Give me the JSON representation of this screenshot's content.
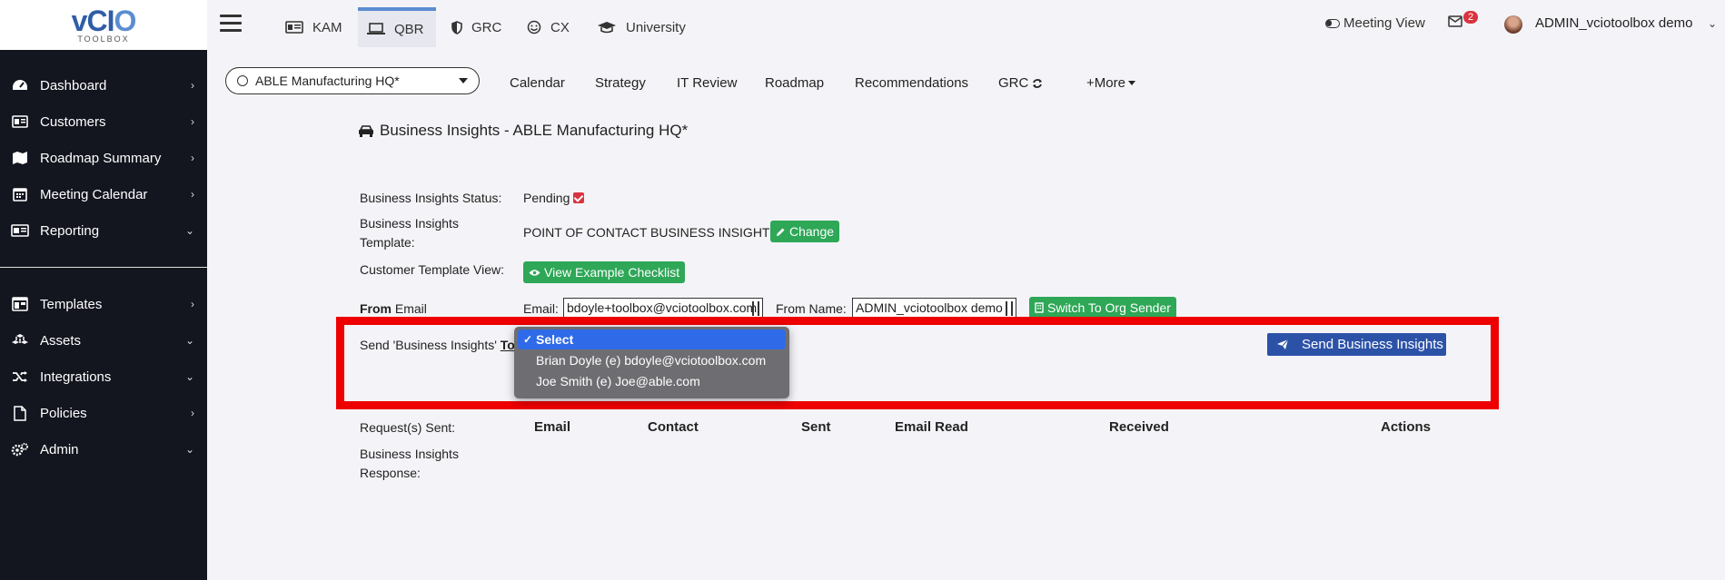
{
  "logo": {
    "main_v": "v",
    "main_c": "C",
    "main_i": "I",
    "main_o": "O",
    "sub": "TOOLBOX"
  },
  "sidebar": {
    "items": [
      {
        "label": "Dashboard",
        "icon": "dashboard-icon",
        "chevron": "›"
      },
      {
        "label": "Customers",
        "icon": "id-card-icon",
        "chevron": "›"
      },
      {
        "label": "Roadmap Summary",
        "icon": "map-icon",
        "chevron": "›"
      },
      {
        "label": "Meeting Calendar",
        "icon": "calendar-icon",
        "chevron": "›"
      },
      {
        "label": "Reporting",
        "icon": "report-icon",
        "chevron": "⌄"
      },
      {
        "label": "Templates",
        "icon": "template-icon",
        "chevron": "›"
      },
      {
        "label": "Assets",
        "icon": "cubes-icon",
        "chevron": "⌄"
      },
      {
        "label": "Integrations",
        "icon": "shuffle-icon",
        "chevron": "⌄"
      },
      {
        "label": "Policies",
        "icon": "file-icon",
        "chevron": "›"
      },
      {
        "label": "Admin",
        "icon": "gears-icon",
        "chevron": "⌄"
      }
    ]
  },
  "topbar": {
    "tabs": [
      {
        "label": "KAM",
        "icon": "id-badge-icon"
      },
      {
        "label": "QBR",
        "icon": "laptop-icon"
      },
      {
        "label": "GRC",
        "icon": "shield-icon"
      },
      {
        "label": "CX",
        "icon": "smile-icon"
      },
      {
        "label": "University",
        "icon": "graduation-cap-icon"
      }
    ],
    "meeting_view": "Meeting View",
    "mail_count": "2",
    "username": "ADMIN_vciotoolbox demo",
    "user_chevron": "⌄"
  },
  "customer_select": {
    "value": "ABLE Manufacturing HQ*"
  },
  "subnav": {
    "items": [
      "Calendar",
      "Strategy",
      "IT Review",
      "Roadmap",
      "Recommendations",
      "GRC",
      "+More"
    ]
  },
  "page": {
    "title": "Business Insights - ABLE Manufacturing HQ*",
    "status_label": "Business Insights Status:",
    "status_value": "Pending",
    "template_label_1": "Business Insights",
    "template_label_2": "Template:",
    "template_value": "POINT OF CONTACT BUSINESS INSIGHTS",
    "change_button": "Change",
    "customer_view_label": "Customer Template View:",
    "view_example_button": "View Example Checklist",
    "from_label_bold": "From",
    "from_label_rest": " Email",
    "email_prefix": "Email:",
    "email_value": "bdoyle+toolbox@vciotoolbox.com",
    "from_name_prefix": "From Name:",
    "from_name_value": "ADMIN_vciotoolbox demo",
    "switch_button": "Switch To Org Sender",
    "send_label": "Send 'Business Insights'",
    "send_label_to": "To",
    "send_button": "Send Business Insights",
    "dropdown_options": [
      {
        "label": "Select",
        "selected": true
      },
      {
        "label": "Brian Doyle (e) bdoyle@vciotoolbox.com",
        "selected": false
      },
      {
        "label": "Joe Smith (e) Joe@able.com",
        "selected": false
      }
    ],
    "requests_label": "Request(s) Sent:",
    "table_headers": [
      "Email",
      "Contact",
      "Sent",
      "Email Read",
      "Received",
      "Actions"
    ],
    "response_label_1": "Business Insights",
    "response_label_2": "Response:"
  },
  "colors": {
    "sidebar_bg": "#13151f",
    "accent_blue": "#2c52a8",
    "green": "#2ea757",
    "highlight_red": "#ee0000",
    "badge_red": "#d9333f"
  }
}
